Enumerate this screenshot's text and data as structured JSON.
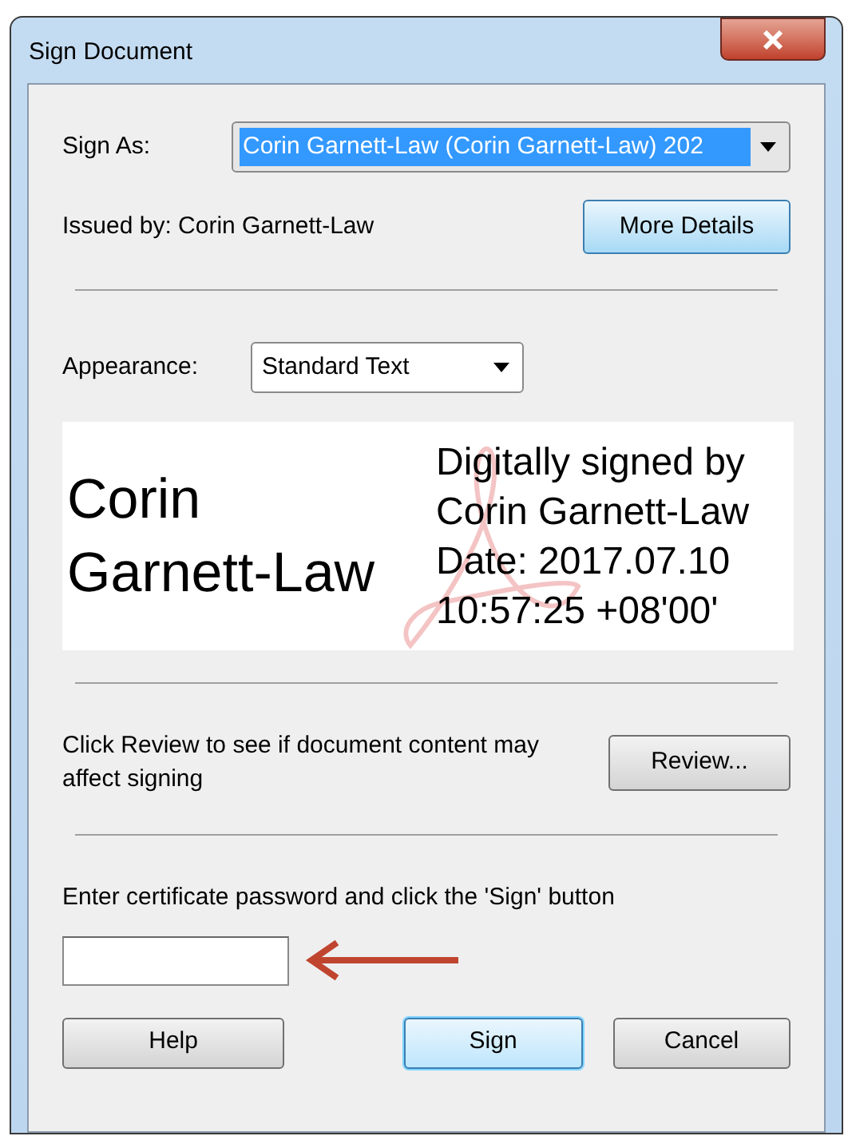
{
  "window": {
    "title": "Sign Document"
  },
  "sign_as": {
    "label": "Sign As:",
    "value": "Corin Garnett-Law (Corin Garnett-Law) 202"
  },
  "issued_by": "Issued by: Corin Garnett-Law",
  "more_details": "More Details",
  "appearance": {
    "label": "Appearance:",
    "value": "Standard Text"
  },
  "preview": {
    "name_lines": [
      "Corin",
      "Garnett-Law"
    ],
    "detail_lines": [
      "Digitally signed by",
      "Corin Garnett-Law",
      "Date: 2017.07.10",
      "10:57:25 +08'00'"
    ]
  },
  "review": {
    "text": "Click Review to see if document content may affect signing",
    "button": "Review..."
  },
  "password": {
    "label": "Enter certificate password and click the 'Sign' button"
  },
  "buttons": [
    {
      "label": "Help",
      "default": false
    },
    {
      "label": "Sign",
      "default": true
    },
    {
      "label": "Cancel",
      "default": false
    }
  ]
}
